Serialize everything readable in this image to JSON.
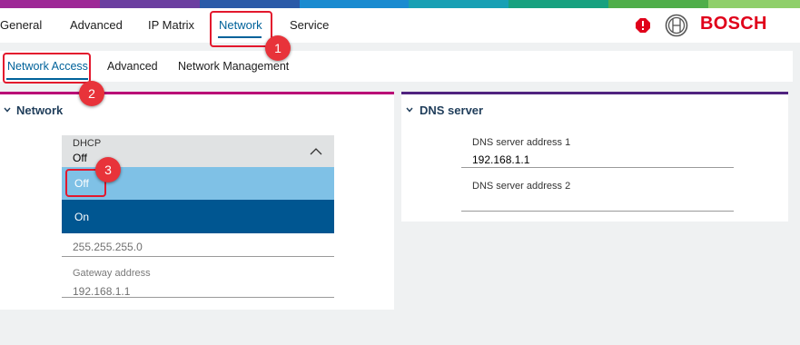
{
  "brand": {
    "name": "BOSCH",
    "stripe_colors": [
      "#9e2896",
      "#6b3fa0",
      "#2b5aa8",
      "#1a8bd0",
      "#18a0b4",
      "#17a17f",
      "#4fae4a",
      "#8fcf6a"
    ]
  },
  "top_nav": {
    "items": [
      {
        "label": "General"
      },
      {
        "label": "Advanced"
      },
      {
        "label": "IP Matrix"
      },
      {
        "label": "Network"
      },
      {
        "label": "Service"
      }
    ],
    "active": "Network"
  },
  "sub_nav": {
    "items": [
      {
        "label": "Network Access"
      },
      {
        "label": "Advanced"
      },
      {
        "label": "Network Management"
      }
    ],
    "active": "Network Access"
  },
  "network_section": {
    "title": "Network",
    "dhcp": {
      "label": "DHCP",
      "value": "Off",
      "options": [
        "Off",
        "On"
      ]
    },
    "subnet_value": "255.255.255.0",
    "gateway": {
      "label": "Gateway address",
      "value": "192.168.1.1"
    }
  },
  "dns_section": {
    "title": "DNS server",
    "dns1": {
      "label": "DNS server address 1",
      "value": "192.168.1.1"
    },
    "dns2": {
      "label": "DNS server address 2",
      "value": ""
    }
  },
  "annotations": [
    "1",
    "2",
    "3"
  ],
  "colors": {
    "accent": "#00629a",
    "alert_red": "#e0001a",
    "option_highlight": "#7fc1e6",
    "option_dark": "#005691"
  }
}
